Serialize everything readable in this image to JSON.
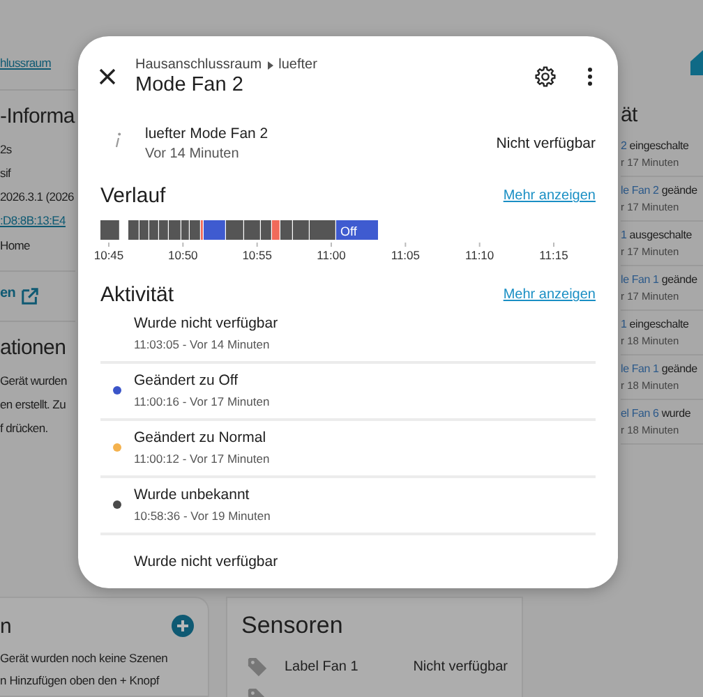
{
  "background": {
    "left_top": [
      {
        "kind": "link",
        "text": "hlussraum"
      },
      {
        "kind": "divider"
      },
      {
        "kind": "heading",
        "text": "-Informa"
      },
      {
        "kind": "text",
        "text": "2s"
      },
      {
        "kind": "text",
        "text": "sif"
      },
      {
        "kind": "text",
        "text": "2026.3.1 (2026"
      },
      {
        "kind": "link",
        "text": ":D8:8B:13:E4"
      },
      {
        "kind": "text",
        "text": "Home"
      },
      {
        "kind": "divider"
      },
      {
        "kind": "extlink",
        "text": "en"
      },
      {
        "kind": "divider"
      },
      {
        "kind": "heading",
        "text": "ationen"
      },
      {
        "kind": "text",
        "text": "Gerät wurden"
      },
      {
        "kind": "text",
        "text": "en erstellt. Zu"
      },
      {
        "kind": "text",
        "text": "f drücken."
      }
    ],
    "scenes_card": {
      "title": "n",
      "lines": [
        "Gerät wurden noch keine Szenen",
        "n Hinzufügen oben den + Knopf"
      ]
    },
    "sensors_card": {
      "title": "Sensoren",
      "rows": [
        {
          "kind": "entity",
          "name": "Label Fan 1",
          "state": "Nicht verfügbar"
        },
        {
          "kind": "icon_only"
        }
      ]
    },
    "right_strip": {
      "heading": "ät",
      "rows": [
        {
          "link": "2",
          "text": " eingeschalte",
          "time": "r 17 Minuten"
        },
        {
          "link": "le Fan 2",
          "text": " geände",
          "time": "r 17 Minuten"
        },
        {
          "link": "1",
          "text": " ausgeschalte",
          "time": "r 17 Minuten"
        },
        {
          "link": "le Fan 1",
          "text": " geände",
          "time": "r 17 Minuten"
        },
        {
          "link": "1",
          "text": " eingeschalte",
          "time": "r 18 Minuten"
        },
        {
          "link": "le Fan 1",
          "text": " geände",
          "time": "r 18 Minuten"
        },
        {
          "link": "el Fan 6",
          "text": " wurde",
          "time": "r 18 Minuten"
        }
      ]
    }
  },
  "dialog": {
    "breadcrumb": [
      "Hausanschlussraum",
      "luefter"
    ],
    "title": "Mode Fan 2",
    "entity": {
      "name": "luefter Mode Fan 2",
      "changed": "Vor 14 Minuten",
      "state": "Nicht verfügbar"
    },
    "history": {
      "title": "Verlauf",
      "more": "Mehr anzeigen",
      "segment_label": "Off",
      "axis": [
        "10:45",
        "10:50",
        "10:55",
        "11:00",
        "11:05",
        "11:10",
        "11:15"
      ]
    },
    "activity": {
      "title": "Aktivität",
      "more": "Mehr anzeigen",
      "items": [
        {
          "title": "Wurde nicht verfügbar",
          "time": "11:03:05 - Vor 14 Minuten"
        },
        {
          "title": "Geändert zu Off",
          "time": "11:00:16 - Vor 17 Minuten",
          "color": "#3b55c9"
        },
        {
          "title": "Geändert zu Normal",
          "time": "11:00:12 - Vor 17 Minuten",
          "color": "#f4b24e"
        },
        {
          "title": "Wurde unbekannt",
          "time": "10:58:36 - Vor 19 Minuten",
          "color": "#4a4a4a"
        },
        {
          "title": "Wurde nicht verfügbar"
        }
      ]
    }
  }
}
